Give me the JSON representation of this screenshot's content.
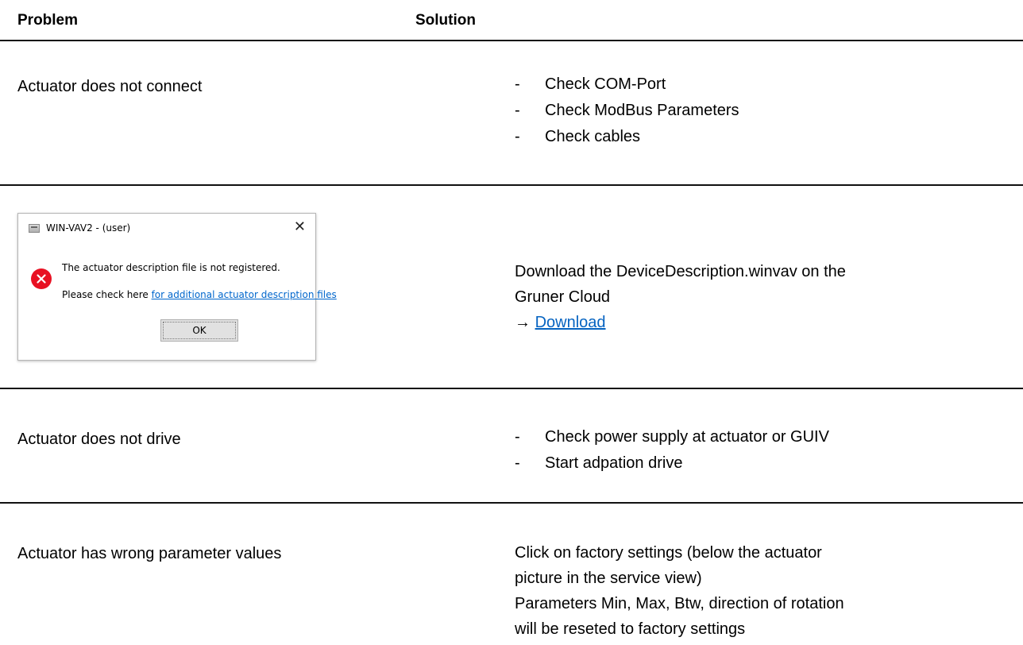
{
  "table": {
    "header": {
      "problem": "Problem",
      "solution": "Solution"
    },
    "rows": [
      {
        "problem": "Actuator does not connect",
        "solutions": [
          "Check COM-Port",
          "Check ModBus Parameters",
          "Check cables"
        ]
      },
      {
        "dialog": {
          "title": "WIN-VAV2 - (user)",
          "close_glyph": "✕",
          "message": "The actuator description file is not registered.",
          "prompt": "Please check here ",
          "link": "for additional actuator description files",
          "ok_label": "OK"
        },
        "solution_lines": [
          "Download the DeviceDescription.winvav on the",
          "Gruner Cloud"
        ],
        "arrow": "→ ",
        "download_link": "Download"
      },
      {
        "problem": "Actuator does not drive",
        "solutions": [
          "Check power supply at actuator or GUIV",
          "Start adpation drive"
        ]
      },
      {
        "problem": "Actuator has wrong parameter values",
        "solution_lines": [
          "Click on factory settings (below the actuator",
          "picture in the service view)",
          "Parameters Min, Max, Btw, direction of rotation",
          "will be reseted to factory settings"
        ]
      }
    ],
    "list_dash": "-"
  },
  "colors": {
    "link": "#0563c1",
    "error": "#e81123",
    "rule": "#111111"
  }
}
